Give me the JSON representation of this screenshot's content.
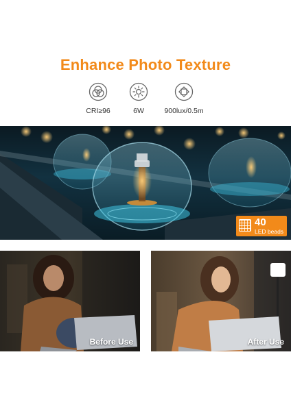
{
  "title": "Enhance Photo Texture",
  "specs": [
    {
      "icon": "color-circles-icon",
      "label": "CRI≥96"
    },
    {
      "icon": "sun-power-icon",
      "label": "6W"
    },
    {
      "icon": "brightness-icon",
      "label": "900lux/0.5m"
    }
  ],
  "badge": {
    "icon": "led-grid-icon",
    "count": "40",
    "label": "LED beads"
  },
  "photos": {
    "before": "Before Use",
    "after": "After Use"
  },
  "colors": {
    "accent": "#f28a1a"
  }
}
